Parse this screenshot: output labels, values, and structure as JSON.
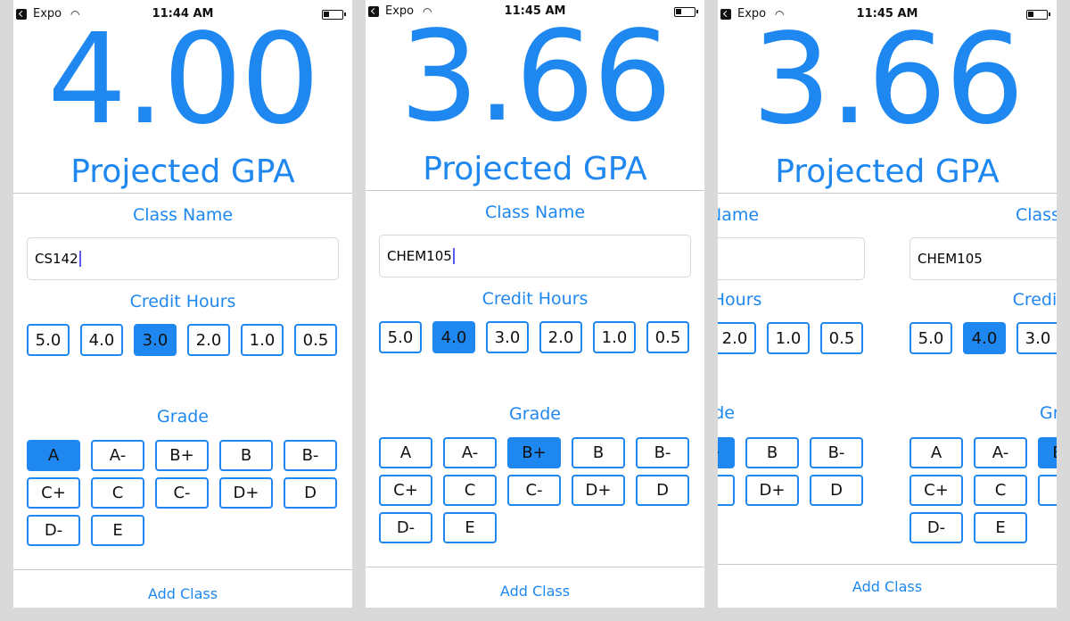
{
  "status_bar": {
    "carrier": "Expo",
    "time1": "11:44 AM",
    "time2": "11:45 AM",
    "time3": "11:45 AM"
  },
  "gpa_label": "Projected GPA",
  "class_name_label": "Class Name",
  "credit_hours_label": "Credit Hours",
  "grade_label": "Grade",
  "add_class_label": "Add Class",
  "credit_options": [
    "5.0",
    "4.0",
    "3.0",
    "2.0",
    "1.0",
    "0.5"
  ],
  "grade_options": [
    "A",
    "A-",
    "B+",
    "B",
    "B-",
    "C+",
    "C",
    "C-",
    "D+",
    "D",
    "D-",
    "E"
  ],
  "screens": [
    {
      "gpa": "4.00",
      "class_name": "CS142",
      "selected_credit": "3.0",
      "selected_grade": "A"
    },
    {
      "gpa": "3.66",
      "class_name": "CHEM105",
      "selected_credit": "4.0",
      "selected_grade": "B+"
    },
    {
      "gpa": "3.66",
      "class_name": "CHEM105",
      "selected_credit": "4.0",
      "selected_grade": "B+"
    }
  ],
  "colors": {
    "accent": "#1e87f0",
    "text": "#111111",
    "divider": "#c8c8c8"
  }
}
